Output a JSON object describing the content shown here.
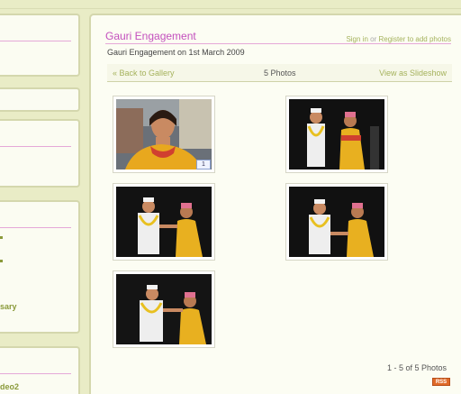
{
  "gallery": {
    "title": "Gauri Engagement",
    "subtitle": "Gauri Engagement on 1st March 2009",
    "sign_in": "Sign in",
    "or": "or",
    "register": "Register to add photos"
  },
  "nav": {
    "back": "« Back to Gallery",
    "photo_count": "5 Photos",
    "slideshow": "View as Slideshow"
  },
  "photos": [
    {
      "badge": "1"
    },
    {},
    {},
    {},
    {}
  ],
  "sidebar": {
    "text_1": "sary",
    "text_2": "deo2"
  },
  "pager": "1 - 5 of 5 Photos",
  "rss_label": "RSS",
  "colors": {
    "background": "#e9ecc6",
    "title_pink": "#c34fbd",
    "link_green": "#a5b25c",
    "rule_pink": "#e5a8d8"
  }
}
